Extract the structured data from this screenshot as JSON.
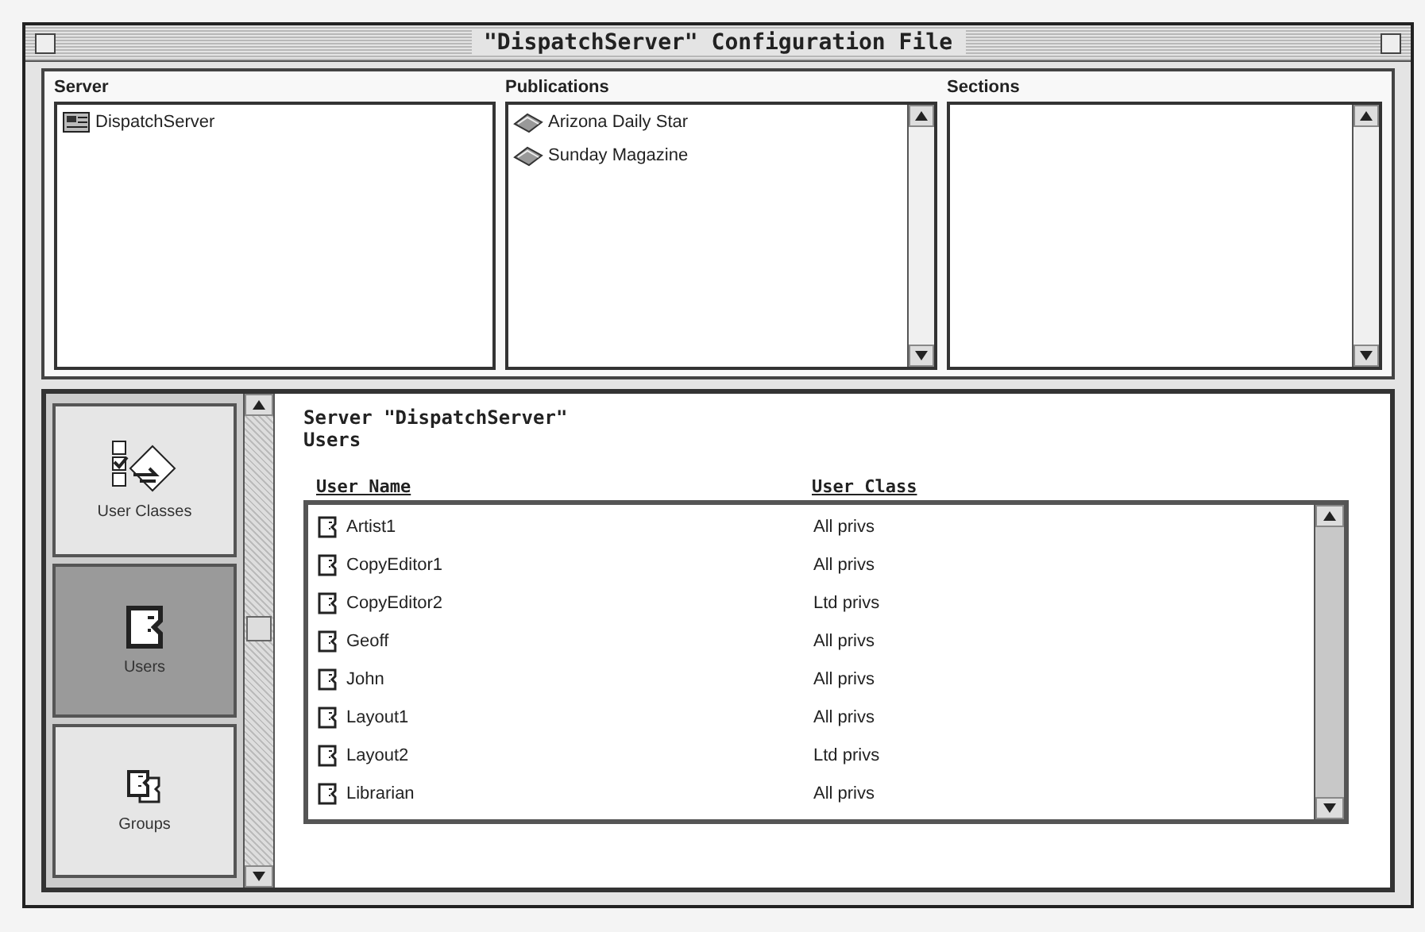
{
  "window": {
    "title": "\"DispatchServer\" Configuration File"
  },
  "panes": [
    {
      "header": "Server",
      "kind": "server",
      "items": [
        "DispatchServer"
      ]
    },
    {
      "header": "Publications",
      "kind": "publication",
      "items": [
        "Arizona Daily Star",
        "Sunday Magazine"
      ]
    },
    {
      "header": "Sections",
      "kind": "section"
    }
  ],
  "nav": [
    {
      "label": "User Classes",
      "kind": "classes",
      "selected": false
    },
    {
      "label": "Users",
      "kind": "user",
      "selected": true
    },
    {
      "label": "Groups",
      "kind": "group",
      "selected": false
    }
  ],
  "content": {
    "title": "Server \"DispatchServer\"",
    "subtitle": "Users",
    "columns": [
      "User Name",
      "User Class"
    ],
    "rows": [
      {
        "name": "Artist1",
        "class": "All privs"
      },
      {
        "name": "CopyEditor1",
        "class": "All privs"
      },
      {
        "name": "CopyEditor2",
        "class": "Ltd privs"
      },
      {
        "name": "Geoff",
        "class": "All privs"
      },
      {
        "name": "John",
        "class": "All privs"
      },
      {
        "name": "Layout1",
        "class": "All privs"
      },
      {
        "name": "Layout2",
        "class": "Ltd privs"
      },
      {
        "name": "Librarian",
        "class": "All privs"
      }
    ]
  }
}
